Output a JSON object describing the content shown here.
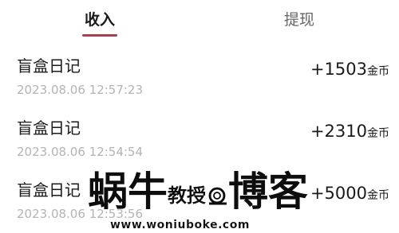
{
  "tabs": {
    "income_label": "收入",
    "withdraw_label": "提现",
    "active": "收入"
  },
  "records": [
    {
      "title": "盲盒日记",
      "time": "2023.08.06 12:57:23",
      "amount": "+1503",
      "unit": "金币"
    },
    {
      "title": "盲盒日记",
      "time": "2023.08.06 12:54:54",
      "amount": "+2310",
      "unit": "金币"
    },
    {
      "title": "盲盒日记",
      "time": "2023.08.06 12:53:56",
      "amount": "+5000",
      "unit": "金币"
    }
  ],
  "watermark": {
    "brand": "蜗牛教授博客",
    "url": "www.woniuboke.com"
  },
  "colors": {
    "active_tab_underline": "#a8414e",
    "timestamp": "#b4b4b4",
    "watermark": "#111111"
  }
}
